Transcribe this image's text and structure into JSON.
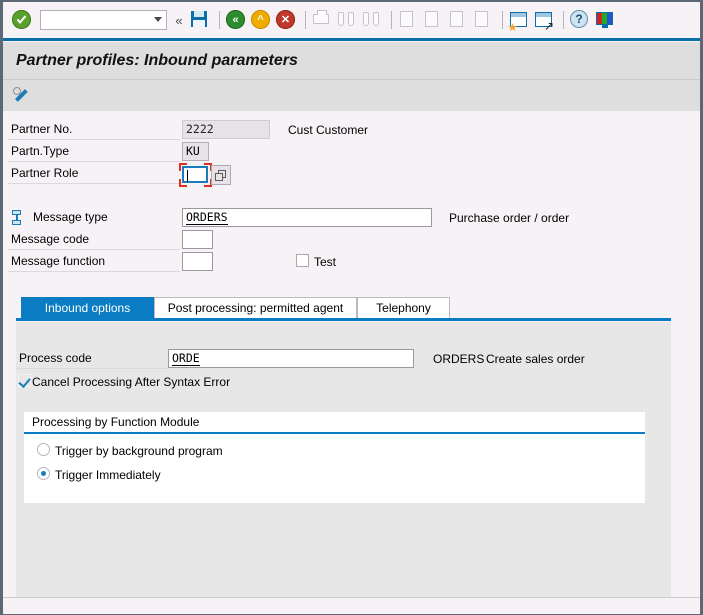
{
  "window": {
    "title": "Partner profiles: Inbound parameters",
    "border_color": "#5b6876"
  },
  "toolbar": {
    "command_field_value": "",
    "command_field_placeholder": "",
    "icons": [
      {
        "name": "enter-check-icon",
        "label": "Continue (Enter)"
      },
      {
        "name": "command-field-collapse-icon",
        "label": "«"
      },
      {
        "name": "save-icon",
        "label": "Save"
      },
      {
        "name": "back-icon",
        "label": "Back"
      },
      {
        "name": "exit-icon",
        "label": "Exit"
      },
      {
        "name": "cancel-icon",
        "label": "Cancel"
      },
      {
        "name": "print-icon",
        "label": "Print"
      },
      {
        "name": "find-icon",
        "label": "Find"
      },
      {
        "name": "find-next-icon",
        "label": "Find Next"
      },
      {
        "name": "first-page-icon",
        "label": "First Page"
      },
      {
        "name": "previous-page-icon",
        "label": "Previous Page"
      },
      {
        "name": "next-page-icon",
        "label": "Next Page"
      },
      {
        "name": "last-page-icon",
        "label": "Last Page"
      },
      {
        "name": "create-session-icon",
        "label": "Create New Session"
      },
      {
        "name": "create-shortcut-icon",
        "label": "Create Shortcut"
      },
      {
        "name": "help-icon",
        "label": "Help"
      },
      {
        "name": "customize-local-layout-icon",
        "label": "Customize Local Layout"
      }
    ]
  },
  "app_toolbar": {
    "icons": [
      {
        "name": "display-change-pencil-icon",
        "label": "Display <-> Change"
      }
    ]
  },
  "header_form": {
    "rows": [
      {
        "label": "Partner No.",
        "value": "2222",
        "side_text": "Cust Customer",
        "field_state": "disabled",
        "field_name": "partner-no-field"
      },
      {
        "label": "Partn.Type",
        "value": "KU",
        "side_text": "",
        "field_state": "readonly",
        "field_name": "partner-type-field"
      },
      {
        "label": "Partner Role",
        "value": "",
        "side_text": "",
        "field_state": "focused",
        "field_name": "partner-role-field"
      }
    ]
  },
  "message_form": {
    "rows": [
      {
        "label": "Message type",
        "value": "ORDERS",
        "side_text": "Purchase order / order",
        "field_name": "message-type-field"
      },
      {
        "label": "Message code",
        "value": "",
        "side_text": "",
        "field_name": "message-code-field"
      },
      {
        "label": "Message function",
        "value": "",
        "side_text": "",
        "field_name": "message-function-field"
      }
    ],
    "test_checkbox": {
      "label": "Test",
      "checked": false
    }
  },
  "tabs": [
    {
      "label": "Inbound options",
      "active": true,
      "name": "tab-inbound-options"
    },
    {
      "label": "Post processing: permitted agent",
      "active": false,
      "name": "tab-post-processing"
    },
    {
      "label": "Telephony",
      "active": false,
      "name": "tab-telephony"
    }
  ],
  "inbound_options": {
    "process_code": {
      "label": "Process code",
      "value": "ORDE",
      "side_text_code": "ORDERS",
      "side_text_desc": "Create sales order"
    },
    "cancel_processing": {
      "label": "Cancel Processing After Syntax Error",
      "checked": true
    },
    "processing_group": {
      "title": "Processing by Function Module",
      "options": [
        {
          "label": "Trigger by background program",
          "selected": false,
          "name": "radio-trigger-background"
        },
        {
          "label": "Trigger Immediately",
          "selected": true,
          "name": "radio-trigger-immediately"
        }
      ]
    }
  },
  "colors": {
    "accent_blue": "#0a7cc4",
    "title_band": "#dedede",
    "canvas": "#f6f2f6",
    "panel": "#e7e7e7",
    "focus_corner_red": "#e03020"
  }
}
